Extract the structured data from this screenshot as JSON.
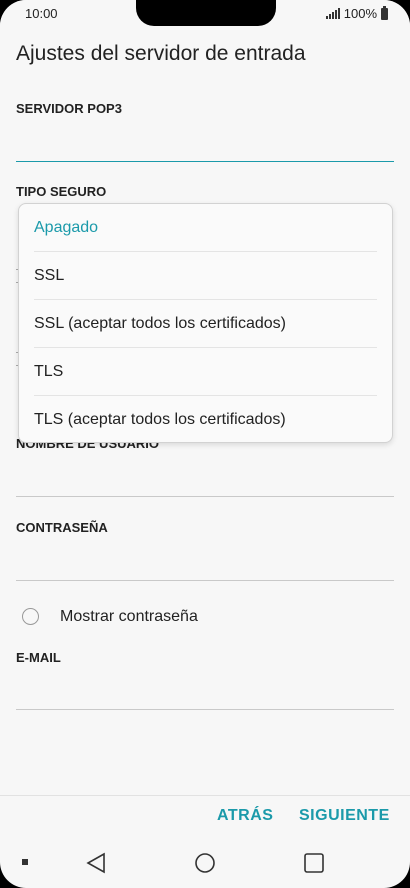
{
  "statusbar": {
    "time": "10:00",
    "battery": "100%"
  },
  "page": {
    "title": "Ajustes del servidor de entrada"
  },
  "fields": {
    "pop3_label": "SERVIDOR POP3",
    "secure_type_label": "TIPO SEGURO",
    "username_label": "NOMBRE DE USUARIO",
    "password_label": "CONTRASEÑA",
    "email_label": "E-MAIL"
  },
  "dropdown": {
    "options": [
      "Apagado",
      "SSL",
      "SSL (aceptar todos los certificados)",
      "TLS",
      "TLS (aceptar todos los certificados)"
    ],
    "selected_index": 0
  },
  "show_password": {
    "label": "Mostrar contraseña",
    "checked": false
  },
  "buttons": {
    "back": "ATRÁS",
    "next": "SIGUIENTE"
  },
  "colors": {
    "accent": "#1b9aaa",
    "background": "#f7f7f7"
  },
  "icons": [
    "signal-icon",
    "battery-icon",
    "back-nav-icon",
    "home-nav-icon",
    "recents-nav-icon"
  ]
}
